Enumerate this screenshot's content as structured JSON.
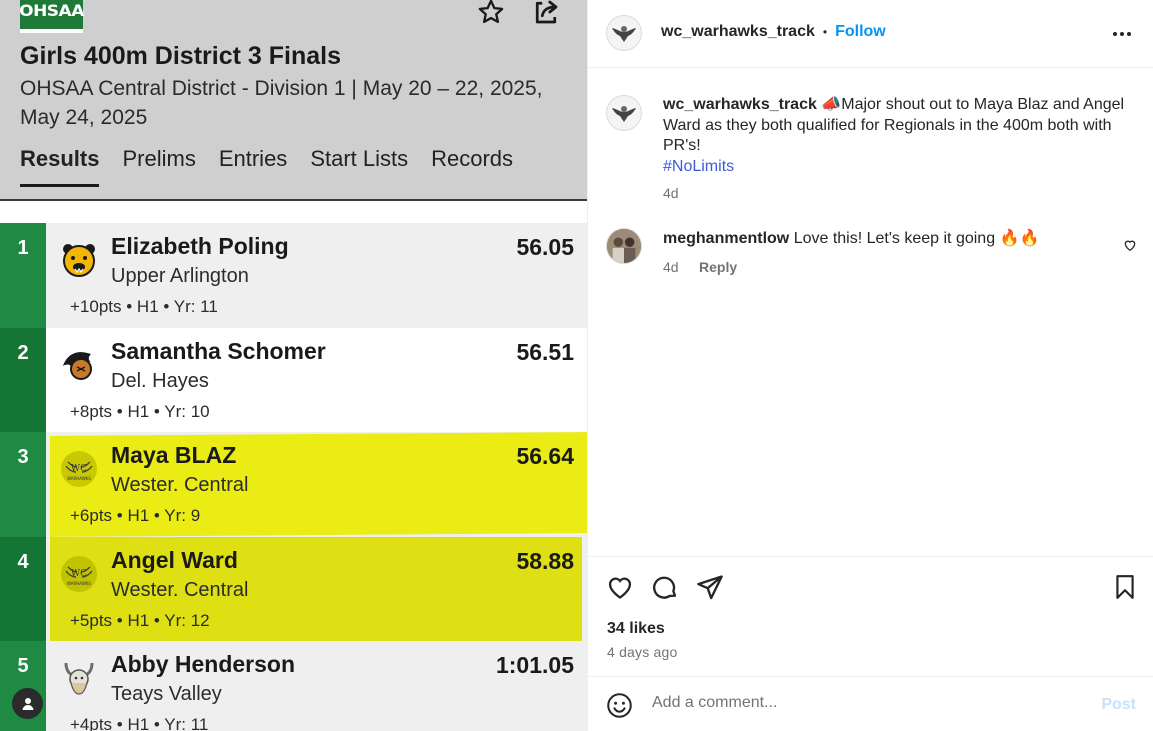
{
  "results": {
    "logo_text": "OHSAA",
    "title": "Girls 400m District 3 Finals",
    "subtitle": "OHSAA Central District - Division 1 | May 20 – 22, 2025, May 24, 2025",
    "tabs": [
      {
        "label": "Results",
        "active": true
      },
      {
        "label": "Prelims",
        "active": false
      },
      {
        "label": "Entries",
        "active": false
      },
      {
        "label": "Start Lists",
        "active": false
      },
      {
        "label": "Records",
        "active": false
      }
    ],
    "rows": [
      {
        "rank": "1",
        "name": "Elizabeth Poling",
        "school": "Upper Arlington",
        "meta": "+10pts • H1 • Yr: 11",
        "mark": "56.05",
        "icon": "bear-mascot-icon",
        "highlighted": false
      },
      {
        "rank": "2",
        "name": "Samantha Schomer",
        "school": "Del. Hayes",
        "meta": "+8pts • H1 • Yr: 10",
        "mark": "56.51",
        "icon": "pacer-mascot-icon",
        "highlighted": false
      },
      {
        "rank": "3",
        "name": "Maya BLAZ",
        "school": "Wester. Central",
        "meta": "+6pts • H1 • Yr: 9",
        "mark": "56.64",
        "icon": "warhawks-logo-icon",
        "highlighted": true
      },
      {
        "rank": "4",
        "name": "Angel Ward",
        "school": "Wester. Central",
        "meta": "+5pts • H1 • Yr: 12",
        "mark": "58.88",
        "icon": "warhawks-logo-icon",
        "highlighted": true
      },
      {
        "rank": "5",
        "name": "Abby Henderson",
        "school": "Teays Valley",
        "meta": "+4pts • H1 • Yr: 11",
        "mark": "1:01.05",
        "icon": "viking-mascot-icon",
        "highlighted": false
      }
    ],
    "highlight_color": "#e9eb00",
    "rank_green": "#1e8a44"
  },
  "post": {
    "username": "wc_warhawks_track",
    "separator": "•",
    "follow_label": "Follow",
    "caption_emoji": "📣",
    "caption": "Major shout out to Maya Blaz and Angel Ward as they both qualified for Regionals in the 400m both with PR's!",
    "hashtag": "#NoLimits",
    "caption_age": "4d",
    "comment": {
      "username": "meghanmentlow",
      "text": "Love this! Let's keep it going 🔥🔥",
      "age": "4d",
      "reply_label": "Reply"
    },
    "likes": "34 likes",
    "posted_ago": "4 days ago",
    "comment_placeholder": "Add a comment...",
    "post_label": "Post",
    "accent": "#0095f6"
  }
}
